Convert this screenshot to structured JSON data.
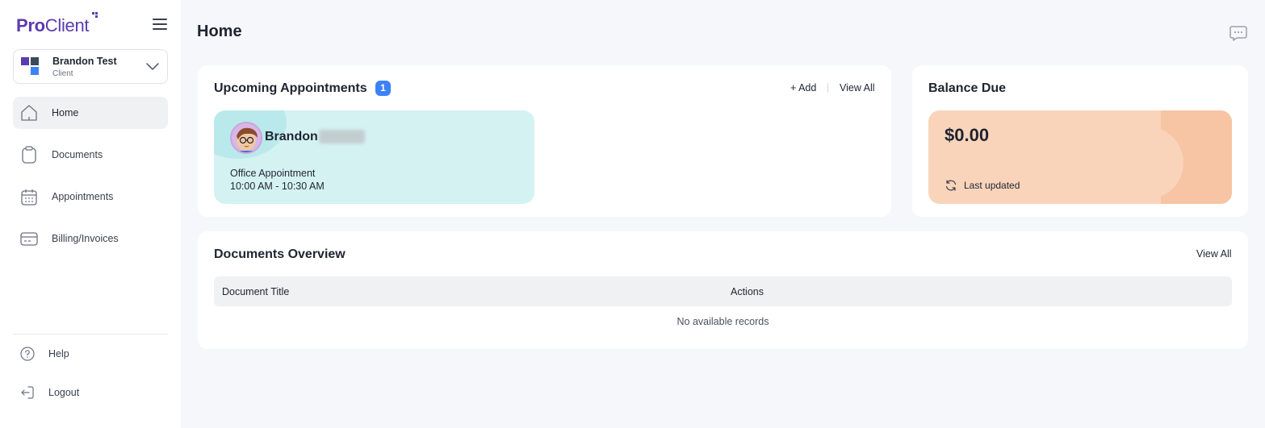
{
  "brand": {
    "pro": "Pro",
    "client": "Client"
  },
  "account": {
    "name": "Brandon Test",
    "role": "Client"
  },
  "nav": [
    {
      "label": "Home",
      "icon": "home-icon",
      "active": true
    },
    {
      "label": "Documents",
      "icon": "clipboard-icon",
      "active": false
    },
    {
      "label": "Appointments",
      "icon": "calendar-icon",
      "active": false
    },
    {
      "label": "Billing/Invoices",
      "icon": "credit-card-icon",
      "active": false
    }
  ],
  "bottom_nav": [
    {
      "label": "Help",
      "icon": "help-icon"
    },
    {
      "label": "Logout",
      "icon": "logout-icon"
    }
  ],
  "page": {
    "title": "Home"
  },
  "appointments": {
    "title": "Upcoming Appointments",
    "count": "1",
    "add_label": "+ Add",
    "view_all_label": "View All",
    "item": {
      "name": "Brandon",
      "type": "Office Appointment",
      "time": "10:00 AM - 10:30 AM"
    }
  },
  "balance": {
    "title": "Balance Due",
    "amount": "$0.00",
    "last_updated": "Last updated"
  },
  "documents": {
    "title": "Documents Overview",
    "view_all_label": "View All",
    "columns": [
      "Document Title",
      "Actions"
    ],
    "empty_text": "No available records"
  },
  "colors": {
    "brand": "#5b3bb0",
    "badge": "#3b82f6",
    "appointment_card": "#d5f2f3",
    "balance_card": "#f9d4bb"
  }
}
